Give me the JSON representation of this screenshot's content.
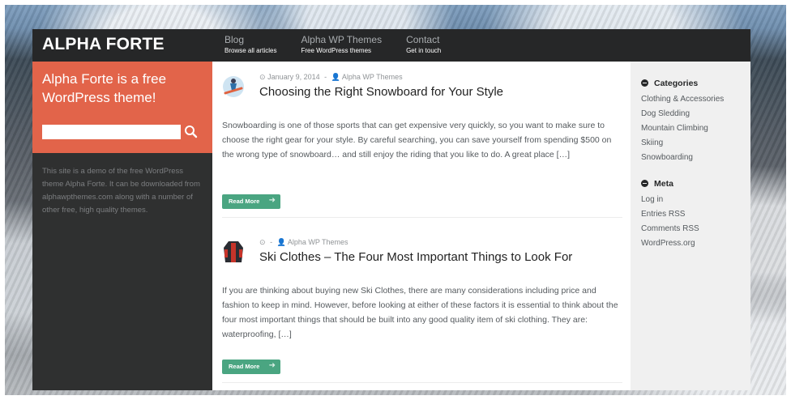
{
  "site": {
    "logo": "ALPHA FORTE"
  },
  "nav": [
    {
      "title": "Blog",
      "subtitle": "Browse all articles"
    },
    {
      "title": "Alpha WP Themes",
      "subtitle": "Free WordPress themes"
    },
    {
      "title": "Contact",
      "subtitle": "Get in touch"
    }
  ],
  "sidebar_left": {
    "promo_title": "Alpha Forte is a free WordPress theme!",
    "search_placeholder": "",
    "description": "This site is a demo of the free WordPress theme Alpha Forte. It can be downloaded from alphawpthemes.com along with a number of other free, high quality themes."
  },
  "posts": [
    {
      "date": "January 9, 2014",
      "author": "Alpha WP Themes",
      "title": "Choosing the Right Snowboard for Your Style",
      "excerpt": "Snowboarding is one of those sports that can get expensive very quickly, so you want to make sure to choose the right gear for your style. By careful searching, you can save yourself from spending $500 on the wrong type of snowboard… and still enjoy the riding that you like to do. A great place […]",
      "read_more": "Read More",
      "thumb_icon": "snowboarder-thumbnail"
    },
    {
      "date": "",
      "author": "Alpha WP Themes",
      "title": "Ski Clothes – The Four Most Important Things to Look For",
      "excerpt": "If you are thinking about buying new Ski Clothes, there are many considerations including price and fashion to keep in mind. However, before looking at either of these factors it is essential to think about the four most important things that should be built into any good quality item of ski clothing. They are: waterproofing, […]",
      "read_more": "Read More",
      "thumb_icon": "ski-jacket-thumbnail"
    }
  ],
  "sidebar_right": {
    "categories_title": "Categories",
    "categories": [
      "Clothing & Accessories",
      "Dog Sledding",
      "Mountain Climbing",
      "Skiing",
      "Snowboarding"
    ],
    "meta_title": "Meta",
    "meta": [
      "Log in",
      "Entries RSS",
      "Comments RSS",
      "WordPress.org"
    ]
  },
  "colors": {
    "header": "#262728",
    "promo": "#e2644a",
    "left_sidebar": "#2f3030",
    "read_more": "#4aa581",
    "right_sidebar": "#f0f0f0"
  }
}
